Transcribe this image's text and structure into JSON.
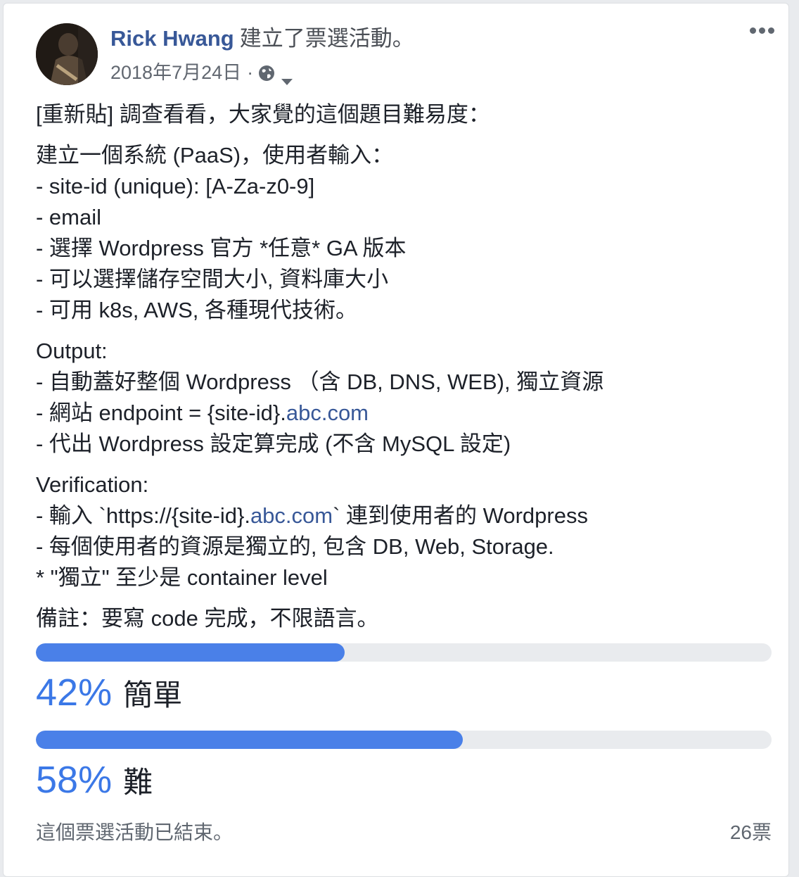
{
  "post": {
    "author": "Rick Hwang",
    "action": "建立了票選活動。",
    "date": "2018年7月24日",
    "meta_separator": "·",
    "privacy_icon": "globe-icon",
    "more_icon": "more-options-icon"
  },
  "body": {
    "intro": "[重新貼] 調查看看，大家覺的這個題目難易度：",
    "spec": {
      "heading": "建立一個系統 (PaaS)，使用者輸入：",
      "l1": "- site-id (unique): [A-Za-z0-9]",
      "l2": "- email",
      "l3": "- 選擇 Wordpress 官方 *任意* GA 版本",
      "l4": "- 可以選擇儲存空間大小, 資料庫大小",
      "l5": "- 可用 k8s, AWS, 各種現代技術。"
    },
    "output": {
      "heading": "Output:",
      "l1": "- 自動蓋好整個 Wordpress （含 DB, DNS, WEB), 獨立資源",
      "l2_prefix": "- 網站 endpoint = {site-id}.",
      "l2_link": "abc.com",
      "l3": "- 代出 Wordpress 設定算完成 (不含 MySQL 設定)"
    },
    "verification": {
      "heading": "Verification:",
      "l1_prefix": "- 輸入 `https://{site-id}.",
      "l1_link": "abc.com",
      "l1_suffix": "` 連到使用者的 Wordpress",
      "l2": "- 每個使用者的資源是獨立的, 包含 DB, Web, Storage.",
      "l3": "* \"獨立\" 至少是 container level"
    },
    "note": "備註：要寫 code 完成，不限語言。"
  },
  "poll": {
    "options": [
      {
        "percent_label": "42%",
        "label": "簡單",
        "fraction": 0.42
      },
      {
        "percent_label": "58%",
        "label": "難",
        "fraction": 0.58
      }
    ],
    "status": "這個票選活動已結束。",
    "votes": "26票"
  },
  "colors": {
    "accent": "#4a80e8",
    "link": "#385898",
    "track": "#e9ebee"
  }
}
